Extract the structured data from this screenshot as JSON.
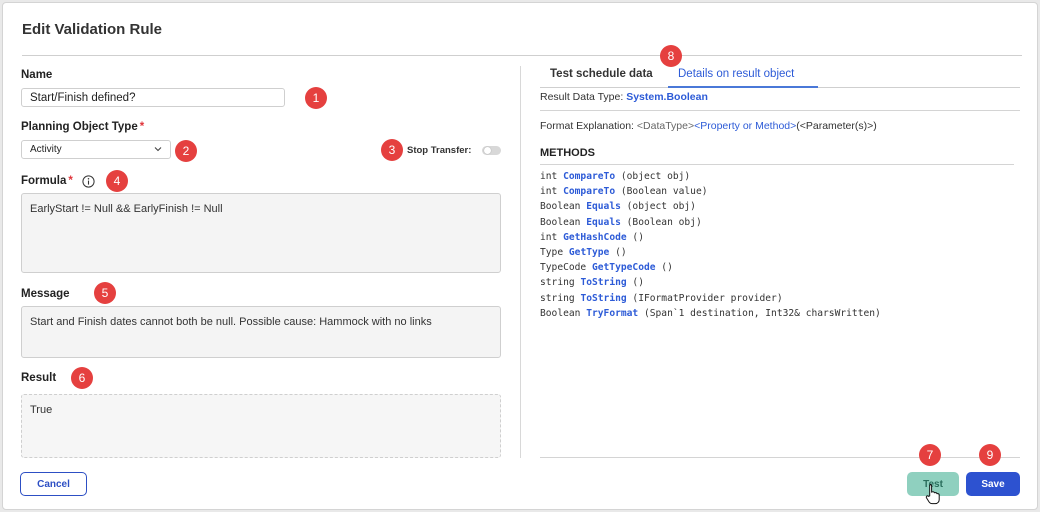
{
  "dialog": {
    "title": "Edit Validation Rule"
  },
  "form": {
    "name_label": "Name",
    "name_value": "Start/Finish defined?",
    "pot_label": "Planning Object Type",
    "required_mark": "*",
    "pot_value": "Activity",
    "stop_transfer_label": "Stop Transfer:",
    "stop_transfer_on": false,
    "formula_label": "Formula",
    "formula_value": "EarlyStart != Null && EarlyFinish != Null",
    "message_label": "Message",
    "message_value": "Start and Finish dates cannot both be null. Possible cause: Hammock with no links",
    "result_label": "Result",
    "result_value": "True"
  },
  "tabs": [
    {
      "label": "Test schedule data",
      "active": false
    },
    {
      "label": "Details on result object",
      "active": true
    }
  ],
  "details": {
    "result_type_label": "Result Data Type:",
    "result_type_value": "System.Boolean",
    "format_label": "Format Explanation:",
    "format_lt": "<DataType>",
    "format_prop": "<Property or Method>",
    "format_params": "(<Parameter(s)>)",
    "methods_heading": "METHODS",
    "methods": [
      {
        "ret": "int",
        "name": "CompareTo",
        "args": "(object obj)"
      },
      {
        "ret": "int",
        "name": "CompareTo",
        "args": "(Boolean value)"
      },
      {
        "ret": "Boolean",
        "name": "Equals",
        "args": "(object obj)"
      },
      {
        "ret": "Boolean",
        "name": "Equals",
        "args": "(Boolean obj)"
      },
      {
        "ret": "int",
        "name": "GetHashCode",
        "args": "()"
      },
      {
        "ret": "Type",
        "name": "GetType",
        "args": "()"
      },
      {
        "ret": "TypeCode",
        "name": "GetTypeCode",
        "args": "()"
      },
      {
        "ret": "string",
        "name": "ToString",
        "args": "()"
      },
      {
        "ret": "string",
        "name": "ToString",
        "args": "(IFormatProvider provider)"
      },
      {
        "ret": "Boolean",
        "name": "TryFormat",
        "args": "(Span`1 destination, Int32& charsWritten)"
      }
    ]
  },
  "buttons": {
    "cancel": "Cancel",
    "test": "Test",
    "save": "Save"
  },
  "badges": [
    "1",
    "2",
    "3",
    "4",
    "5",
    "6",
    "7",
    "8",
    "9"
  ],
  "icons": {
    "info": "info-circle-icon",
    "dropdown": "chevron-down-icon",
    "cursor": "hand-pointer-icon"
  },
  "colors": {
    "accent": "#2d52d0",
    "badge": "#e5403f",
    "test_button": "#8fd0bf"
  }
}
